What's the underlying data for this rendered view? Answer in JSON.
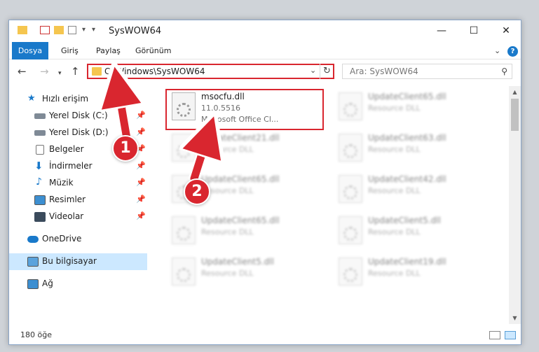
{
  "window": {
    "title": "SysWOW64",
    "controls": {
      "minimize": "—",
      "maximize": "☐",
      "close": "✕"
    }
  },
  "ribbon": {
    "tabs": [
      "Dosya",
      "Giriş",
      "Paylaş",
      "Görünüm"
    ],
    "help": "?"
  },
  "nav": {
    "address": "C:\\Windows\\SysWOW64",
    "search_placeholder": "Ara: SysWOW64"
  },
  "sidebar": {
    "items": [
      {
        "label": "Hızlı erişim",
        "icon": "star-icon",
        "pinned": false
      },
      {
        "label": "Yerel Disk (C:)",
        "icon": "drive-icon",
        "pinned": true
      },
      {
        "label": "Yerel Disk (D:)",
        "icon": "drive-icon",
        "pinned": true
      },
      {
        "label": "Belgeler",
        "icon": "documents-icon",
        "pinned": true
      },
      {
        "label": "İndirmeler",
        "icon": "download-icon",
        "pinned": true
      },
      {
        "label": "Müzik",
        "icon": "music-icon",
        "pinned": true
      },
      {
        "label": "Resimler",
        "icon": "pictures-icon",
        "pinned": true
      },
      {
        "label": "Videolar",
        "icon": "videos-icon",
        "pinned": true
      },
      {
        "label": "OneDrive",
        "icon": "cloud-icon",
        "pinned": false
      },
      {
        "label": "Bu bilgisayar",
        "icon": "computer-icon",
        "pinned": false,
        "selected": true
      },
      {
        "label": "Ağ",
        "icon": "network-icon",
        "pinned": false
      }
    ]
  },
  "files": {
    "highlighted": {
      "name": "msocfu.dll",
      "version": "11.0.5516",
      "description": "Microsoft Office Cl..."
    },
    "others": [
      {
        "name": "UpdateClient65.dll",
        "type": "Resource DLL"
      },
      {
        "name": "UpdateClient21.dll",
        "type": "Resource DLL"
      },
      {
        "name": "UpdateClient63.dll",
        "type": "Resource DLL"
      },
      {
        "name": "UpdateClient65.dll",
        "type": "Resource DLL"
      },
      {
        "name": "UpdateClient42.dll",
        "type": "Resource DLL"
      },
      {
        "name": "UpdateClient65.dll",
        "type": "Resource DLL"
      },
      {
        "name": "UpdateClient5.dll",
        "type": "Resource DLL"
      },
      {
        "name": "UpdateClient5.dll",
        "type": "Resource DLL"
      },
      {
        "name": "UpdateClient19.dll",
        "type": "Resource DLL"
      }
    ]
  },
  "status": {
    "count": "180 öğe"
  },
  "callouts": {
    "step1": "1",
    "step2": "2"
  },
  "colors": {
    "accent": "#1979ca",
    "highlight": "#d9262f",
    "selected": "#cce8ff",
    "folder": "#f5c64f"
  }
}
